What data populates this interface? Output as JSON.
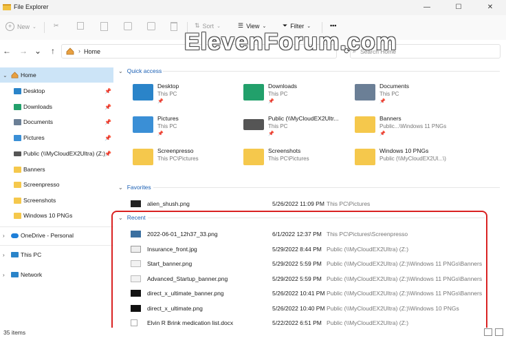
{
  "window": {
    "title": "File Explorer",
    "minimize": "—",
    "maximize": "☐",
    "close": "✕"
  },
  "toolbar": {
    "new_label": "New",
    "sort_label": "Sort",
    "view_label": "View",
    "filter_label": "Filter",
    "more_label": "•••"
  },
  "navigation": {
    "back": "←",
    "forward": "→",
    "recent": "⌄",
    "up": "↑",
    "address_sep": "›",
    "address_text": "Home",
    "refresh": "⟳",
    "search_placeholder": "Search Home"
  },
  "watermark": "ElevenForum.com",
  "sidebar": {
    "items": [
      {
        "label": "Home",
        "icon": "home-icon"
      },
      {
        "label": "Desktop",
        "icon": "desktop-folder-icon",
        "pin": "📌"
      },
      {
        "label": "Downloads",
        "icon": "downloads-folder-icon",
        "pin": "📌"
      },
      {
        "label": "Documents",
        "icon": "documents-folder-icon",
        "pin": "📌"
      },
      {
        "label": "Pictures",
        "icon": "pictures-folder-icon",
        "pin": "📌"
      },
      {
        "label": "Public (\\\\MyCloudEX2Ultra) (Z:)",
        "icon": "network-drive-icon",
        "pin": "📌"
      },
      {
        "label": "Banners",
        "icon": "folder-icon"
      },
      {
        "label": "Screenpresso",
        "icon": "folder-icon"
      },
      {
        "label": "Screenshots",
        "icon": "folder-icon"
      },
      {
        "label": "Windows 10 PNGs",
        "icon": "folder-icon"
      },
      {
        "label": "OneDrive - Personal",
        "icon": "onedrive-icon"
      },
      {
        "label": "This PC",
        "icon": "pc-icon"
      },
      {
        "label": "Network",
        "icon": "network-icon"
      }
    ]
  },
  "sections": {
    "quick_access": "Quick access",
    "favorites": "Favorites",
    "recent": "Recent"
  },
  "quick_access": [
    {
      "name": "Desktop",
      "location": "This PC",
      "pinned": "📌"
    },
    {
      "name": "Downloads",
      "location": "This PC",
      "pinned": "📌"
    },
    {
      "name": "Documents",
      "location": "This PC",
      "pinned": "📌"
    },
    {
      "name": "Pictures",
      "location": "This PC",
      "pinned": "📌"
    },
    {
      "name": "Public (\\\\MyCloudEX2Ultr...",
      "location": "This PC",
      "pinned": "📌"
    },
    {
      "name": "Banners",
      "location": "Public...\\Windows 11 PNGs",
      "pinned": "📌"
    },
    {
      "name": "Screenpresso",
      "location": "This PC\\Pictures",
      "pinned": ""
    },
    {
      "name": "Screenshots",
      "location": "This PC\\Pictures",
      "pinned": ""
    },
    {
      "name": "Windows 10 PNGs",
      "location": "Public (\\\\MyCloudEX2Ul...\\)",
      "pinned": ""
    }
  ],
  "favorites": [
    {
      "name": "alien_shush.png",
      "date": "5/26/2022 11:09 PM",
      "location": "This PC\\Pictures"
    }
  ],
  "recent": [
    {
      "name": "2022-06-01_12h37_33.png",
      "date": "6/1/2022 12:37 PM",
      "location": "This PC\\Pictures\\Screenpresso"
    },
    {
      "name": "Insurance_front.jpg",
      "date": "5/29/2022 8:44 PM",
      "location": "Public (\\\\MyCloudEX2Ultra) (Z:)"
    },
    {
      "name": "Start_banner.png",
      "date": "5/29/2022 5:59 PM",
      "location": "Public (\\\\MyCloudEX2Ultra) (Z:)\\Windows 11 PNGs\\Banners"
    },
    {
      "name": "Advanced_Startup_banner.png",
      "date": "5/29/2022 5:59 PM",
      "location": "Public (\\\\MyCloudEX2Ultra) (Z:)\\Windows 11 PNGs\\Banners"
    },
    {
      "name": "direct_x_ultimate_banner.png",
      "date": "5/26/2022 10:41 PM",
      "location": "Public (\\\\MyCloudEX2Ultra) (Z:)\\Windows 11 PNGs\\Banners"
    },
    {
      "name": "direct_x_ultimate.png",
      "date": "5/26/2022 10:40 PM",
      "location": "Public (\\\\MyCloudEX2Ultra) (Z:)\\Windows 10 PNGs"
    },
    {
      "name": "Elvin R Brink medication list.docx",
      "date": "5/22/2022 6:51 PM",
      "location": "Public (\\\\MyCloudEX2Ultra) (Z:)"
    }
  ],
  "status": {
    "items_count": "35 items"
  },
  "colors": {
    "accent": "#1a5fb4",
    "selection": "#cce4f7",
    "folder": "#f5c84c",
    "highlight_border": "#d92020"
  }
}
